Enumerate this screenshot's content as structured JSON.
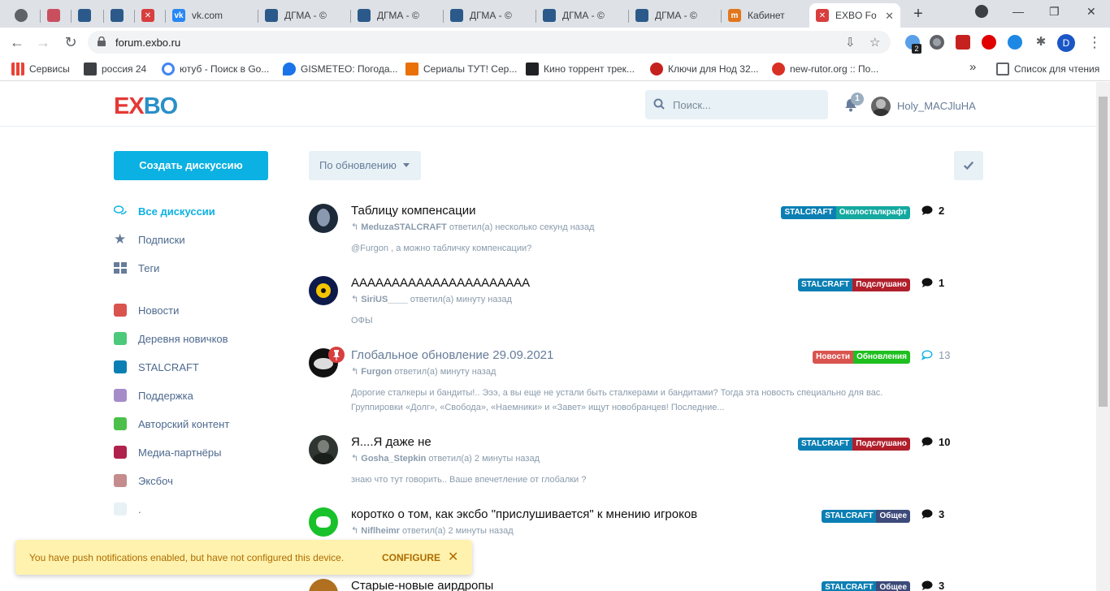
{
  "browser": {
    "tabs": [
      {
        "label": "",
        "color": "#5f6368"
      },
      {
        "label": "",
        "color": "#c94f5f"
      },
      {
        "label": "",
        "color": "#2b5a8a"
      },
      {
        "label": "",
        "color": "#2b5a8a"
      },
      {
        "label": "",
        "color": "#d83e3e"
      },
      {
        "label": "vk.com",
        "color": "#2787f5"
      },
      {
        "label": "ДГМА - ©",
        "color": "#2b5a8a"
      },
      {
        "label": "ДГМА - ©",
        "color": "#2b5a8a"
      },
      {
        "label": "ДГМА - ©",
        "color": "#2b5a8a"
      },
      {
        "label": "ДГМА - ©",
        "color": "#2b5a8a"
      },
      {
        "label": "ДГМА - ©",
        "color": "#2b5a8a"
      },
      {
        "label": "Кабинет",
        "color": "#e2761b"
      },
      {
        "label": "EXBO Fo",
        "color": "#d83e3e"
      }
    ],
    "url": "forum.exbo.ru",
    "profile_initial": "D",
    "ext_badge": "2",
    "bookmarks": [
      {
        "label": "Сервисы",
        "color": "#ea4335"
      },
      {
        "label": "россия 24",
        "color": "#3c4043"
      },
      {
        "label": "ютуб - Поиск в Go...",
        "color": "#4285f4"
      },
      {
        "label": "GISMETEO: Погода...",
        "color": "#1a73e8"
      },
      {
        "label": "Сериалы ТУТ! Сер...",
        "color": "#e8710a"
      },
      {
        "label": "Кино торрент трек...",
        "color": "#202124"
      },
      {
        "label": "Ключи для Нод 32...",
        "color": "#c5221f"
      },
      {
        "label": "new-rutor.org :: По...",
        "color": "#d93025"
      }
    ],
    "more_bookmarks": "»",
    "reading_list": "Список для чтения"
  },
  "header": {
    "logo_part1": "EX",
    "logo_part2": "BO",
    "search_placeholder": "Поиск...",
    "notif_count": "1",
    "username": "Holy_MACJluHA"
  },
  "sidebar": {
    "create_label": "Создать дискуссию",
    "items": [
      {
        "label": "Все дискуссии"
      },
      {
        "label": "Подписки"
      },
      {
        "label": "Теги"
      }
    ],
    "tags": [
      {
        "label": "Новости",
        "color": "#d9534f"
      },
      {
        "label": "Деревня новичков",
        "color": "#4cc97a"
      },
      {
        "label": "STALCRAFT",
        "color": "#0b7fb3"
      },
      {
        "label": "Поддержка",
        "color": "#a58cc9"
      },
      {
        "label": "Авторский контент",
        "color": "#4cc04a"
      },
      {
        "label": "Медиа-партнёры",
        "color": "#b0214d"
      },
      {
        "label": "Эксбоч",
        "color": "#c48c8c"
      },
      {
        "label": ".",
        "color": "#e7f1f6"
      }
    ]
  },
  "toolbar": {
    "sort_label": "По обновлению"
  },
  "discussions": [
    {
      "title": "Таблицу компенсации",
      "user": "MeduzaSTALCRAFT",
      "action": " ответил(а) несколько секунд назад",
      "excerpt": "@Furgon , а можно табличку компенсации?",
      "tag1": "STALCRAFT",
      "tag1_color": "#0b7fb3",
      "tag2": "Околосталкрафт",
      "tag2_color": "#14a9a0",
      "count": "2"
    },
    {
      "title": "АААААААААААААААААААААА",
      "user": "SiriUS____",
      "action": " ответил(а) минуту назад",
      "excerpt": "ОФЫ",
      "tag1": "STALCRAFT",
      "tag1_color": "#0b7fb3",
      "tag2": "Подслушано",
      "tag2_color": "#b01f2b",
      "count": "1"
    },
    {
      "title": "Глобальное обновление 29.09.2021",
      "user": "Furgon",
      "action": " ответил(а) минуту назад",
      "excerpt": "Дорогие сталкеры и бандиты!.. Эээ, а вы еще не устали быть сталкерами и бандитами? Тогда эта новость специально для вас. Группировки «Долг», «Свобода», «Наемники» и «Завет» ищут новобранцев! Последние...",
      "tag1": "Новости",
      "tag1_color": "#d9534f",
      "tag2": "Обновления",
      "tag2_color": "#1fbf1f",
      "count": "13"
    },
    {
      "title": "Я....Я даже не",
      "user": "Gosha_Stepkin",
      "action": " ответил(а) 2 минуты назад",
      "excerpt": "знаю что тут говорить.. Ваше впечетление от глобалки ?",
      "tag1": "STALCRAFT",
      "tag1_color": "#0b7fb3",
      "tag2": "Подслушано",
      "tag2_color": "#b01f2b",
      "count": "10"
    },
    {
      "title": "коротко о том, как эксбо \"прислушивается\" к мнению игроков",
      "user": "Niflheimr",
      "action": " ответил(а) 2 минуты назад",
      "excerpt": "",
      "tag1": "STALCRAFT",
      "tag1_color": "#0b7fb3",
      "tag2": "Общее",
      "tag2_color": "#3d4a7a",
      "count": "3"
    },
    {
      "title": "Старые-новые аирдропы",
      "user": "",
      "action": "",
      "excerpt": "",
      "tag1": "STALCRAFT",
      "tag1_color": "#0b7fb3",
      "tag2": "Общее",
      "tag2_color": "#3d4a7a",
      "count": "3"
    }
  ],
  "toast": {
    "message": "You have push notifications enabled, but have not configured this device.",
    "configure_label": "CONFIGURE",
    "close_label": "✕"
  },
  "colors": {
    "accent": "#0bb1e2",
    "logo_red": "#e53935",
    "logo_blue": "#2a8fc8"
  }
}
